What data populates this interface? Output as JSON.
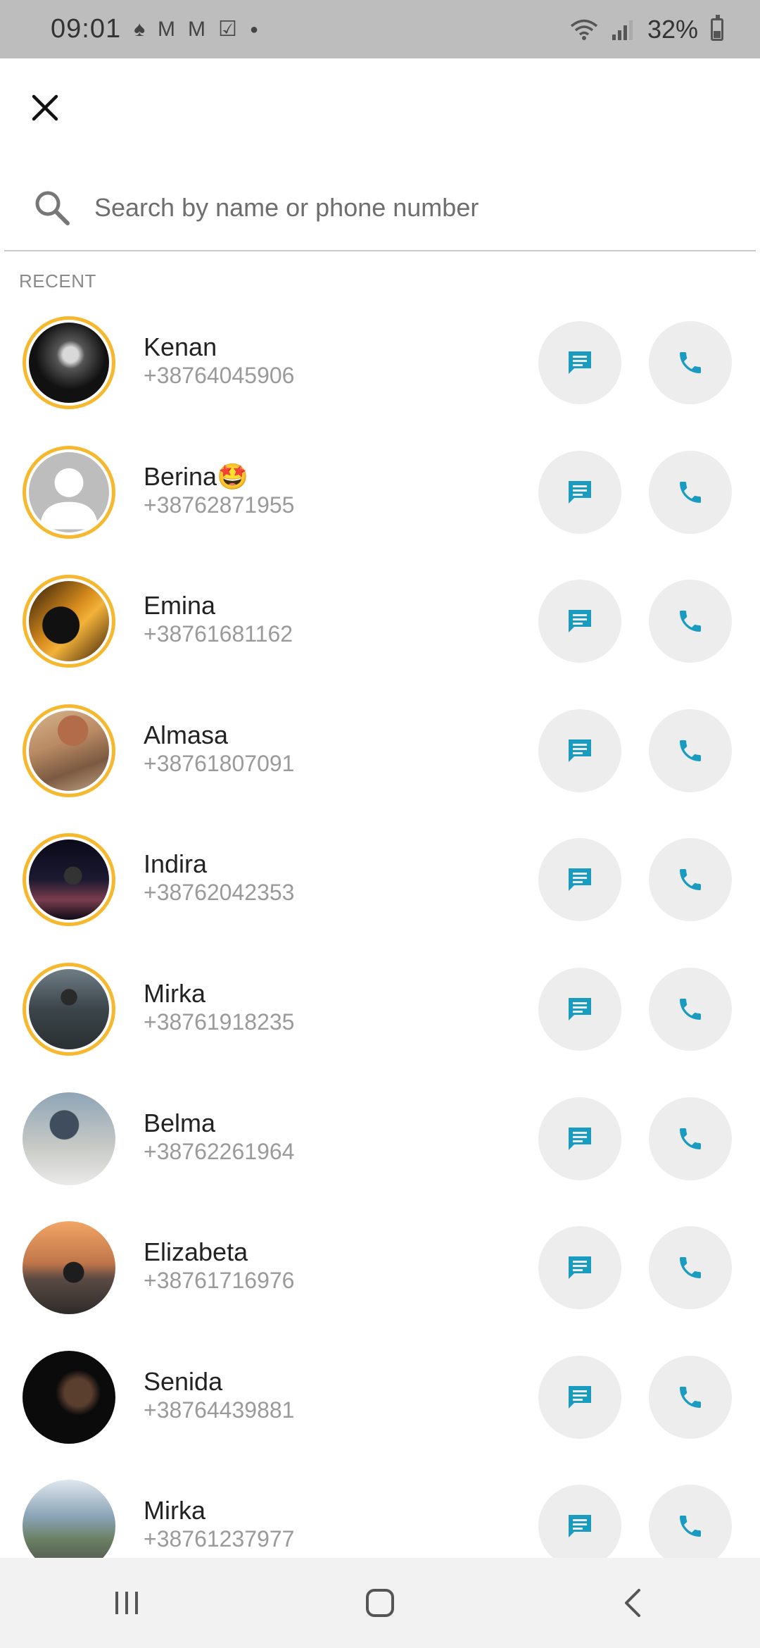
{
  "status_bar": {
    "time": "09:01",
    "battery": "32%",
    "left_icons": [
      "android-debug-icon",
      "gmail-icon",
      "gmail-icon",
      "checkbox-icon",
      "dot-icon"
    ],
    "right_icons": [
      "wifi-icon",
      "signal-icon",
      "battery-icon"
    ]
  },
  "header": {
    "close_icon": "close-icon"
  },
  "search": {
    "placeholder": "Search by name or phone number",
    "icon": "search-icon"
  },
  "section": {
    "label": "RECENT"
  },
  "contacts": [
    {
      "name": "Kenan",
      "phone": "+38764045906",
      "story": true
    },
    {
      "name": "Berina🤩",
      "phone": "+38762871955",
      "story": true
    },
    {
      "name": "Emina",
      "phone": "+38761681162",
      "story": true
    },
    {
      "name": "Almasa",
      "phone": "+38761807091",
      "story": true
    },
    {
      "name": "Indira",
      "phone": "+38762042353",
      "story": true
    },
    {
      "name": "Mirka",
      "phone": "+38761918235",
      "story": true
    },
    {
      "name": "Belma",
      "phone": "+38762261964",
      "story": false
    },
    {
      "name": "Elizabeta",
      "phone": "+38761716976",
      "story": false
    },
    {
      "name": "Senida",
      "phone": "+38764439881",
      "story": false
    },
    {
      "name": "Mirka",
      "phone": "+38761237977",
      "story": false
    }
  ],
  "colors": {
    "accent": "#1a9cc1",
    "story_ring": "#f5b82e",
    "button_bg": "#ededed"
  },
  "nav": {
    "buttons": [
      "recents-icon",
      "home-icon",
      "back-icon"
    ]
  }
}
